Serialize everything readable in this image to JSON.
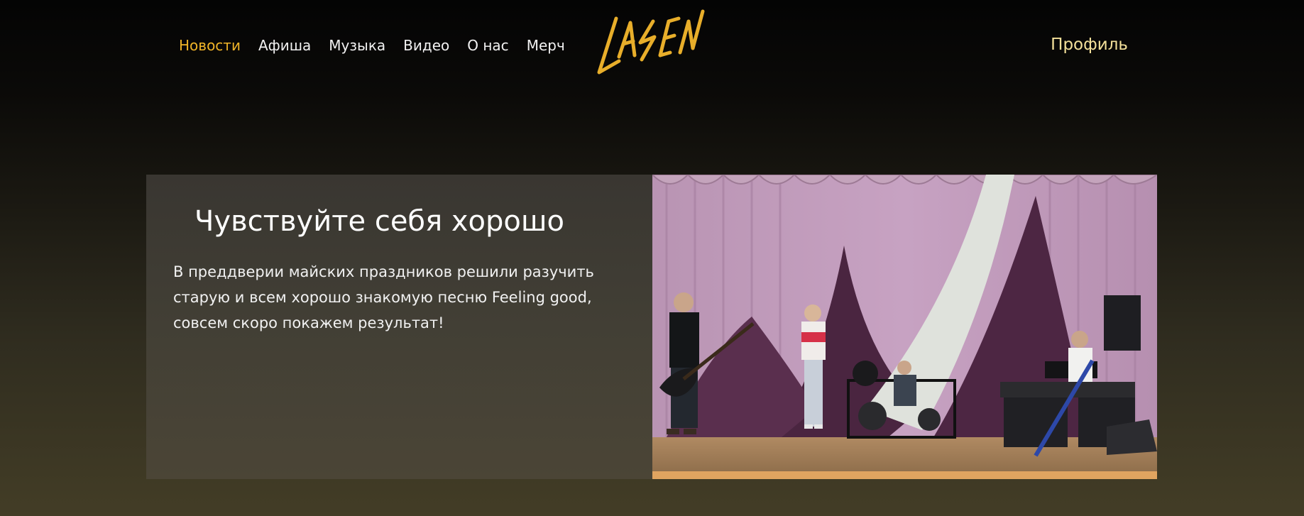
{
  "nav": {
    "items": [
      {
        "label": "Новости",
        "active": true
      },
      {
        "label": "Афиша",
        "active": false
      },
      {
        "label": "Музыка",
        "active": false
      },
      {
        "label": "Видео",
        "active": false
      },
      {
        "label": "О нас",
        "active": false
      },
      {
        "label": "Мерч",
        "active": false
      }
    ]
  },
  "logo": {
    "text": "LASEN"
  },
  "profile": {
    "label": "Профиль"
  },
  "news": {
    "title": "Чувствуйте себя хорошо",
    "body": "В преддверии майских праздников решили разучить старую и всем хорошо знакомую песню Feeling good, совсем скоро покажем результат!"
  },
  "colors": {
    "accent": "#f0b428",
    "profile": "#f3e09a",
    "nav_text": "#f2f2f2"
  }
}
